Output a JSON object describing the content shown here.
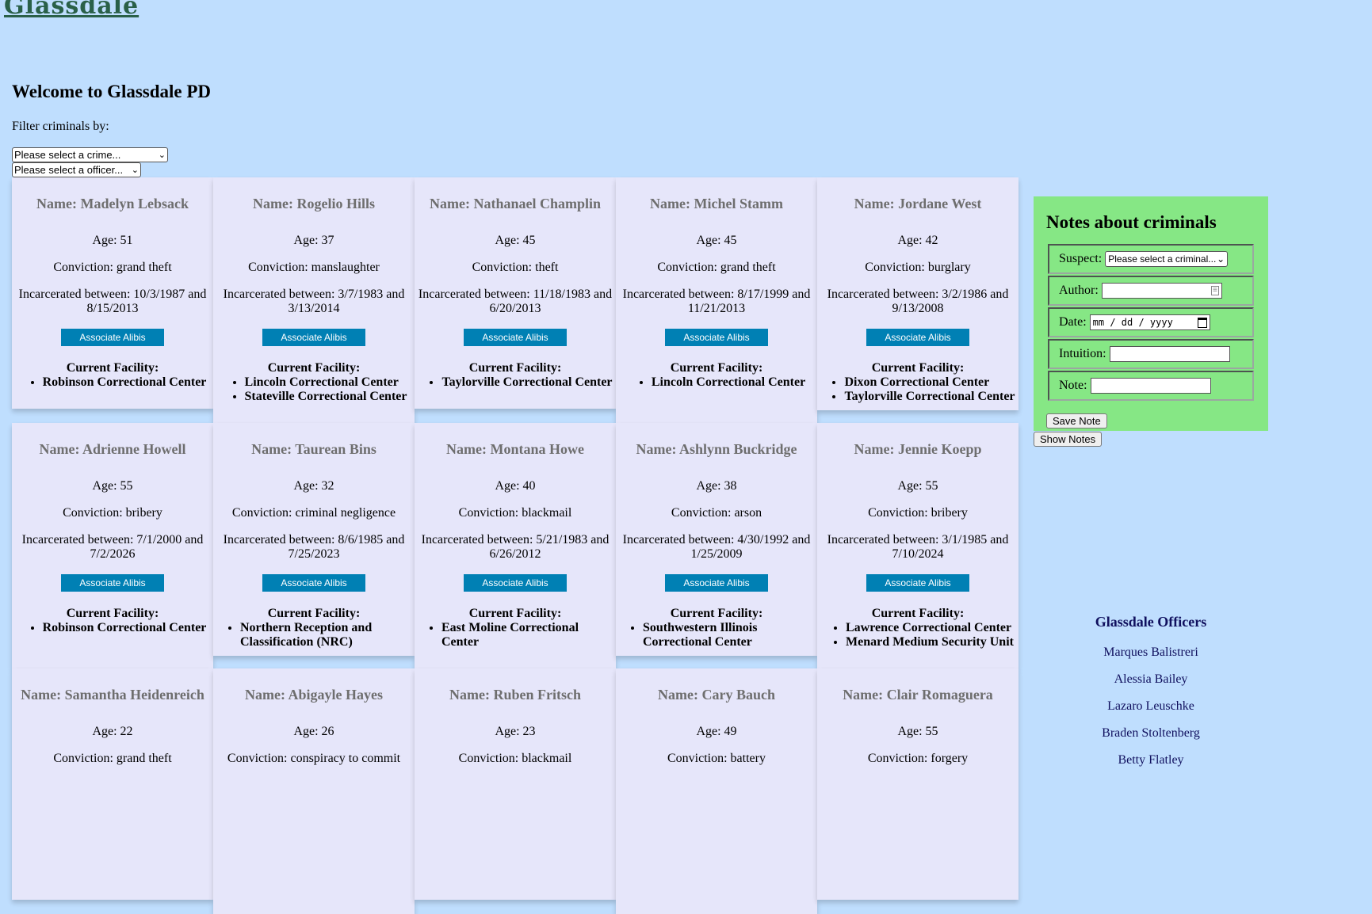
{
  "logo": "Glassdale",
  "welcome": "Welcome to Glassdale PD",
  "filter_label": "Filter criminals by:",
  "crime_select": "Please select a crime...",
  "officer_select": "Please select a officer...",
  "associate_label": "Associate Alibis",
  "facility_label": "Current Facility:",
  "criminals": [
    {
      "name": "Name: Madelyn Lebsack",
      "age": "Age: 51",
      "conviction": "Conviction: grand theft",
      "incarcerated": "Incarcerated between: 10/3/1987 and 8/15/2013",
      "facilities": [
        "Robinson Correctional Center"
      ]
    },
    {
      "name": "Name: Rogelio Hills",
      "age": "Age: 37",
      "conviction": "Conviction: manslaughter",
      "incarcerated": "Incarcerated between: 3/7/1983 and 3/13/2014",
      "facilities": [
        "Lincoln Correctional Center",
        "Stateville Correctional Center"
      ]
    },
    {
      "name": "Name: Nathanael Champlin",
      "age": "Age: 45",
      "conviction": "Conviction: theft",
      "incarcerated": "Incarcerated between: 11/18/1983 and 6/20/2013",
      "facilities": [
        "Taylorville Correctional Center"
      ]
    },
    {
      "name": "Name: Michel Stamm",
      "age": "Age: 45",
      "conviction": "Conviction: grand theft",
      "incarcerated": "Incarcerated between: 8/17/1999 and 11/21/2013",
      "facilities": [
        "Lincoln Correctional Center"
      ]
    },
    {
      "name": "Name: Jordane West",
      "age": "Age: 42",
      "conviction": "Conviction: burglary",
      "incarcerated": "Incarcerated between: 3/2/1986 and 9/13/2008",
      "facilities": [
        "Dixon Correctional Center",
        "Taylorville Correctional Center"
      ]
    },
    {
      "name": "Name: Adrienne Howell",
      "age": "Age: 55",
      "conviction": "Conviction: bribery",
      "incarcerated": "Incarcerated between: 7/1/2000 and 7/2/2026",
      "facilities": [
        "Robinson Correctional Center"
      ]
    },
    {
      "name": "Name: Taurean Bins",
      "age": "Age: 32",
      "conviction": "Conviction: criminal negligence",
      "incarcerated": "Incarcerated between: 8/6/1985 and 7/25/2023",
      "facilities": [
        "Northern Reception and Classification (NRC)"
      ]
    },
    {
      "name": "Name: Montana Howe",
      "age": "Age: 40",
      "conviction": "Conviction: blackmail",
      "incarcerated": "Incarcerated between: 5/21/1983 and 6/26/2012",
      "facilities": [
        "East Moline Correctional Center"
      ]
    },
    {
      "name": "Name: Ashlynn Buckridge",
      "age": "Age: 38",
      "conviction": "Conviction: arson",
      "incarcerated": "Incarcerated between: 4/30/1992 and 1/25/2009",
      "facilities": [
        "Southwestern Illinois Correctional Center"
      ]
    },
    {
      "name": "Name: Jennie Koepp",
      "age": "Age: 55",
      "conviction": "Conviction: bribery",
      "incarcerated": "Incarcerated between: 3/1/1985 and 7/10/2024",
      "facilities": [
        "Lawrence Correctional Center",
        "Menard Medium Security Unit"
      ]
    },
    {
      "name": "Name: Samantha Heidenreich",
      "age": "Age: 22",
      "conviction": "Conviction: grand theft",
      "incarcerated": "",
      "facilities": []
    },
    {
      "name": "Name: Abigayle Hayes",
      "age": "Age: 26",
      "conviction": "Conviction: conspiracy to commit",
      "incarcerated": "",
      "facilities": []
    },
    {
      "name": "Name: Ruben Fritsch",
      "age": "Age: 23",
      "conviction": "Conviction: blackmail",
      "incarcerated": "",
      "facilities": []
    },
    {
      "name": "Name: Cary Bauch",
      "age": "Age: 49",
      "conviction": "Conviction: battery",
      "incarcerated": "",
      "facilities": []
    },
    {
      "name": "Name: Clair Romaguera",
      "age": "Age: 55",
      "conviction": "Conviction: forgery",
      "incarcerated": "",
      "facilities": []
    }
  ],
  "notes": {
    "title": "Notes about criminals",
    "suspect_label": "Suspect:",
    "suspect_select": "Please select a criminal...",
    "author_label": "Author:",
    "date_label": "Date:",
    "date_placeholder": "mm / dd / yyyy",
    "intuition_label": "Intuition:",
    "note_label": "Note:",
    "save_label": "Save Note",
    "show_label": "Show Notes"
  },
  "officers": {
    "title": "Glassdale Officers",
    "list": [
      "Marques Balistreri",
      "Alessia Bailey",
      "Lazaro Leuschke",
      "Braden Stoltenberg",
      "Betty Flatley"
    ]
  }
}
